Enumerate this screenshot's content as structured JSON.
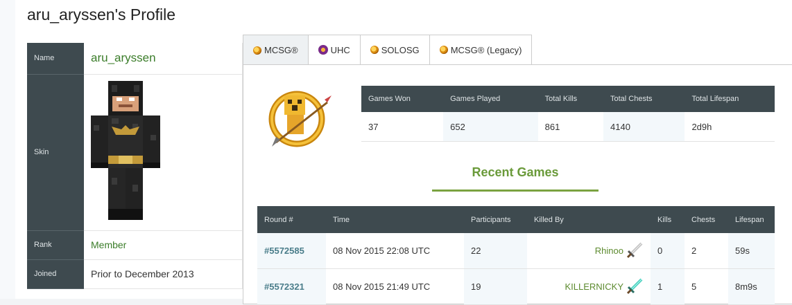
{
  "page": {
    "title": "aru_aryssen's Profile"
  },
  "profile": {
    "name_label": "Name",
    "name_value": "aru_aryssen",
    "skin_label": "Skin",
    "rank_label": "Rank",
    "rank_value": "Member",
    "joined_label": "Joined",
    "joined_value": "Prior to December 2013"
  },
  "tabs": [
    {
      "label": "MCSG®",
      "icon": "mcsg-icon",
      "active": true
    },
    {
      "label": "UHC",
      "icon": "uhc-icon"
    },
    {
      "label": "SOLOSG",
      "icon": "solosg-icon"
    },
    {
      "label": "MCSG® (Legacy)",
      "icon": "mcsg-legacy-icon"
    }
  ],
  "stats": {
    "headers": [
      "Games Won",
      "Games Played",
      "Total Kills",
      "Total Chests",
      "Total Lifespan"
    ],
    "values": [
      "37",
      "652",
      "861",
      "4140",
      "2d9h"
    ]
  },
  "recent": {
    "title": "Recent Games",
    "headers": [
      "Round #",
      "Time",
      "Participants",
      "Killed By",
      "Kills",
      "Chests",
      "Lifespan"
    ],
    "rows": [
      {
        "round": "#5572585",
        "time": "08 Nov 2015 22:08 UTC",
        "participants": "22",
        "killed_by": "Rhinoo",
        "weapon": "iron-sword-icon",
        "kills": "0",
        "chests": "2",
        "lifespan": "59s"
      },
      {
        "round": "#5572321",
        "time": "08 Nov 2015 21:49 UTC",
        "participants": "19",
        "killed_by": "KILLERNICKY",
        "weapon": "diamond-sword-icon",
        "kills": "1",
        "chests": "5",
        "lifespan": "8m9s"
      }
    ]
  },
  "colors": {
    "header_bg": "#3e4a4f",
    "accent_green": "#6a9a3a",
    "link_green": "#3b7d2a"
  }
}
